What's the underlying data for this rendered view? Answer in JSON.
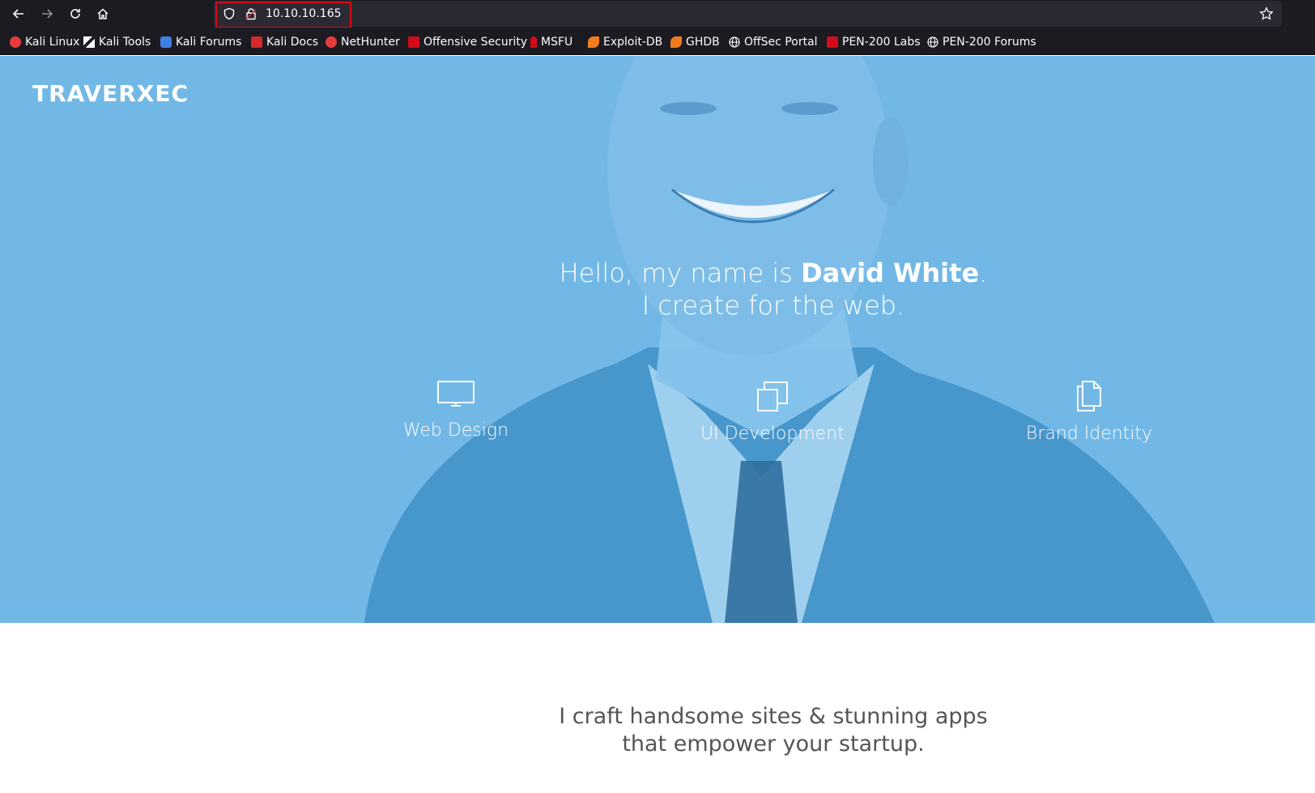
{
  "browser": {
    "url": "10.10.10.165",
    "bookmarks": [
      {
        "label": "Kali Linux",
        "icon": "kali-dragon-icon"
      },
      {
        "label": "Kali Tools",
        "icon": "kali-tools-icon"
      },
      {
        "label": "Kali Forums",
        "icon": "kali-forums-icon"
      },
      {
        "label": "Kali Docs",
        "icon": "kali-docs-icon"
      },
      {
        "label": "NetHunter",
        "icon": "nethunter-icon"
      },
      {
        "label": "Offensive Security",
        "icon": "offsec-icon"
      },
      {
        "label": "MSFU",
        "icon": "msfu-icon"
      },
      {
        "label": "Exploit-DB",
        "icon": "exploit-db-icon"
      },
      {
        "label": "GHDB",
        "icon": "ghdb-icon"
      },
      {
        "label": "OffSec Portal",
        "icon": "globe-icon"
      },
      {
        "label": "PEN-200 Labs",
        "icon": "offsec-icon"
      },
      {
        "label": "PEN-200 Forums",
        "icon": "globe-icon"
      }
    ],
    "colors": {
      "chrome": "#1c1b22",
      "urlbar": "#2b2a33",
      "highlight": "#d40b1a"
    }
  },
  "site": {
    "brand": "TRAVERXEC",
    "headline_pre": "Hello, my name is ",
    "headline_name": "David White",
    "headline_post": ".",
    "headline_line2": "I create for the web.",
    "services": [
      {
        "label": "Web Design",
        "icon": "monitor-icon"
      },
      {
        "label": "UI Development",
        "icon": "stacked-windows-icon"
      },
      {
        "label": "Brand Identity",
        "icon": "documents-icon"
      }
    ],
    "tagline_line1": "I craft handsome sites & stunning apps",
    "tagline_line2": "that empower your startup.",
    "colors": {
      "hero": "#72b8e6",
      "text": "#ffffff",
      "tagline": "#555555"
    }
  }
}
